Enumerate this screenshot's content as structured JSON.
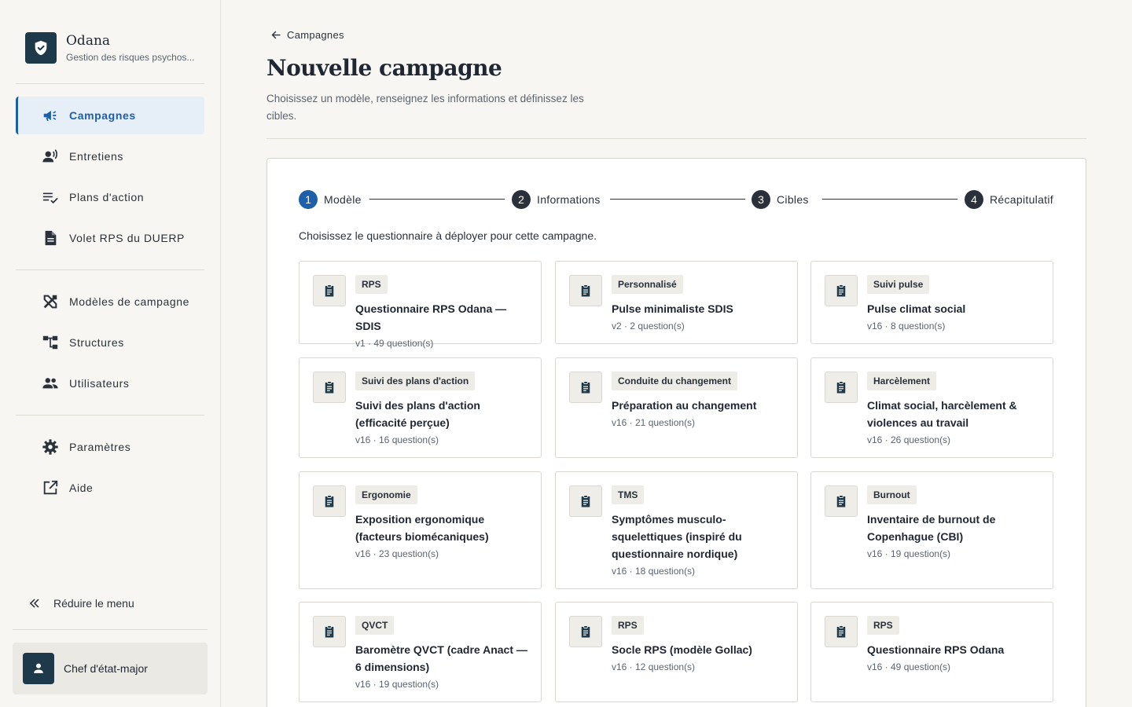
{
  "app": {
    "name": "Odana",
    "subtitle": "Gestion des risques psychos..."
  },
  "sidebar": {
    "items": [
      {
        "label": "Campagnes",
        "icon": "campaign-icon",
        "active": true
      },
      {
        "label": "Entretiens",
        "icon": "record-voice-icon"
      },
      {
        "label": "Plans d'action",
        "icon": "playlist-check-icon"
      },
      {
        "label": "Volet RPS du DUERP",
        "icon": "document-icon"
      },
      {
        "label": "Modèles de campagne",
        "icon": "design-services-icon"
      },
      {
        "label": "Structures",
        "icon": "account-tree-icon"
      },
      {
        "label": "Utilisateurs",
        "icon": "group-icon"
      },
      {
        "label": "Paramètres",
        "icon": "gear-icon"
      },
      {
        "label": "Aide",
        "icon": "open-in-new-icon"
      }
    ],
    "collapse_label": "Réduire le menu",
    "user_name": "Chef d'état-major"
  },
  "header": {
    "back_label": "Campagnes",
    "title": "Nouvelle campagne",
    "description": "Choisissez un modèle, renseignez les informations et définissez les cibles."
  },
  "stepper": {
    "steps": [
      {
        "num": "1",
        "label": "Modèle",
        "active": true
      },
      {
        "num": "2",
        "label": "Informations"
      },
      {
        "num": "3",
        "label": "Cibles"
      },
      {
        "num": "4",
        "label": "Récapitulatif"
      }
    ]
  },
  "instruction": "Choisissez le questionnaire à déployer pour cette campagne.",
  "templates": [
    {
      "tag": "RPS",
      "title": "Questionnaire RPS Odana — SDIS",
      "meta": "v1 · 49 question(s)"
    },
    {
      "tag": "Personnalisé",
      "title": "Pulse minimaliste SDIS",
      "meta": "v2 · 2 question(s)"
    },
    {
      "tag": "Suivi pulse",
      "title": "Pulse climat social",
      "meta": "v16 · 8 question(s)"
    },
    {
      "tag": "Suivi des plans d'action",
      "title": "Suivi des plans d'action (efficacité perçue)",
      "meta": "v16 · 16 question(s)"
    },
    {
      "tag": "Conduite du changement",
      "title": "Préparation au changement",
      "meta": "v16 · 21 question(s)"
    },
    {
      "tag": "Harcèlement",
      "title": "Climat social, harcèlement & violences au travail",
      "meta": "v16 · 26 question(s)"
    },
    {
      "tag": "Ergonomie",
      "title": "Exposition ergonomique (facteurs biomécaniques)",
      "meta": "v16 · 23 question(s)"
    },
    {
      "tag": "TMS",
      "title": "Symptômes musculo-squelettiques (inspiré du questionnaire nordique)",
      "meta": "v16 · 18 question(s)"
    },
    {
      "tag": "Burnout",
      "title": "Inventaire de burnout de Copenhague (CBI)",
      "meta": "v16 · 19 question(s)"
    },
    {
      "tag": "QVCT",
      "title": "Baromètre QVCT (cadre Anact — 6 dimensions)",
      "meta": "v16 · 19 question(s)"
    },
    {
      "tag": "RPS",
      "title": "Socle RPS (modèle Gollac)",
      "meta": "v16 · 12 question(s)"
    },
    {
      "tag": "RPS",
      "title": "Questionnaire RPS Odana",
      "meta": "v16 · 49 question(s)"
    }
  ],
  "colors": {
    "accent": "#1d5fa8",
    "brand": "#1e3a4a",
    "active_bg": "#e6eef8"
  }
}
